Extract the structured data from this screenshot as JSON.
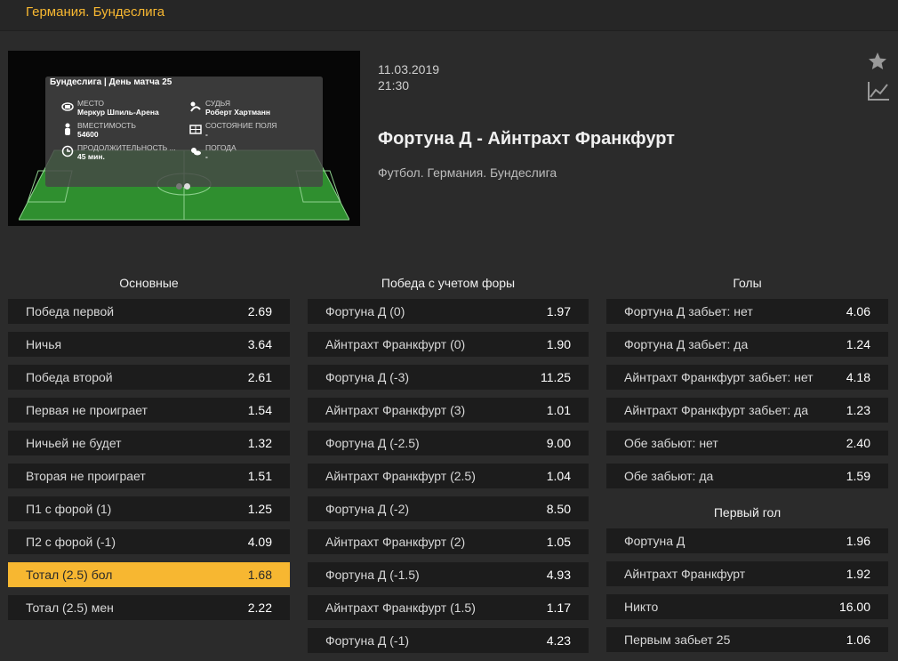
{
  "breadcrumb": "Германия. Бундеслига",
  "widget": {
    "header": "Бундеслига | День матча 25",
    "items": [
      {
        "label": "МЕСТО",
        "value": "Меркур Шпиль-Арена",
        "icon": "stadium-icon"
      },
      {
        "label": "СУДЬЯ",
        "value": "Роберт Хартманн",
        "icon": "referee-icon"
      },
      {
        "label": "ВМЕСТИМОСТЬ",
        "value": "54600",
        "icon": "capacity-icon"
      },
      {
        "label": "СОСТОЯНИЕ ПОЛЯ",
        "value": "-",
        "icon": "pitch-icon"
      },
      {
        "label": "ПРОДОЛЖИТЕЛЬНОСТЬ ...",
        "value": "45 мин.",
        "icon": "clock-icon"
      },
      {
        "label": "ПОГОДА",
        "value": "-",
        "icon": "weather-icon"
      }
    ]
  },
  "match": {
    "date": "11.03.2019",
    "time": "21:30",
    "title": "Фортуна Д - Айнтрахт Франкфурт",
    "subtitle": "Футбол. Германия. Бундеслига"
  },
  "colors": {
    "accent": "#f7b731",
    "row_bg": "#1c1c1c",
    "page_bg": "#2b2b2b"
  },
  "markets": {
    "main": {
      "title": "Основные",
      "rows": [
        {
          "name": "Победа первой",
          "odd": "2.69"
        },
        {
          "name": "Ничья",
          "odd": "3.64"
        },
        {
          "name": "Победа второй",
          "odd": "2.61"
        },
        {
          "name": "Первая не проиграет",
          "odd": "1.54"
        },
        {
          "name": "Ничьей не будет",
          "odd": "1.32"
        },
        {
          "name": "Вторая не проиграет",
          "odd": "1.51"
        },
        {
          "name": "П1 с форой (1)",
          "odd": "1.25"
        },
        {
          "name": "П2 с форой (-1)",
          "odd": "4.09"
        },
        {
          "name": "Тотал (2.5) бол",
          "odd": "1.68"
        },
        {
          "name": "Тотал (2.5) мен",
          "odd": "2.22"
        }
      ]
    },
    "handicap": {
      "title": "Победа с учетом форы",
      "rows": [
        {
          "name": "Фортуна Д (0)",
          "odd": "1.97"
        },
        {
          "name": "Айнтрахт Франкфурт (0)",
          "odd": "1.90"
        },
        {
          "name": "Фортуна Д (-3)",
          "odd": "11.25"
        },
        {
          "name": "Айнтрахт Франкфурт (3)",
          "odd": "1.01"
        },
        {
          "name": "Фортуна Д (-2.5)",
          "odd": "9.00"
        },
        {
          "name": "Айнтрахт Франкфурт (2.5)",
          "odd": "1.04"
        },
        {
          "name": "Фортуна Д (-2)",
          "odd": "8.50"
        },
        {
          "name": "Айнтрахт Франкфурт (2)",
          "odd": "1.05"
        },
        {
          "name": "Фортуна Д (-1.5)",
          "odd": "4.93"
        },
        {
          "name": "Айнтрахт Франкфурт (1.5)",
          "odd": "1.17"
        },
        {
          "name": "Фортуна Д (-1)",
          "odd": "4.23"
        }
      ]
    },
    "goals": {
      "title": "Голы",
      "rows": [
        {
          "name": "Фортуна Д забьет: нет",
          "odd": "4.06"
        },
        {
          "name": "Фортуна Д забьет: да",
          "odd": "1.24"
        },
        {
          "name": "Айнтрахт Франкфурт забьет: нет",
          "odd": "4.18"
        },
        {
          "name": "Айнтрахт Франкфурт забьет: да",
          "odd": "1.23"
        },
        {
          "name": "Обе забьют: нет",
          "odd": "2.40"
        },
        {
          "name": "Обе забьют: да",
          "odd": "1.59"
        }
      ]
    },
    "first_goal": {
      "title": "Первый гол",
      "rows": [
        {
          "name": "Фортуна Д",
          "odd": "1.96"
        },
        {
          "name": "Айнтрахт Франкфурт",
          "odd": "1.92"
        },
        {
          "name": "Никто",
          "odd": "16.00"
        },
        {
          "name": "Первым забьет 25",
          "odd": "1.06"
        }
      ]
    }
  }
}
